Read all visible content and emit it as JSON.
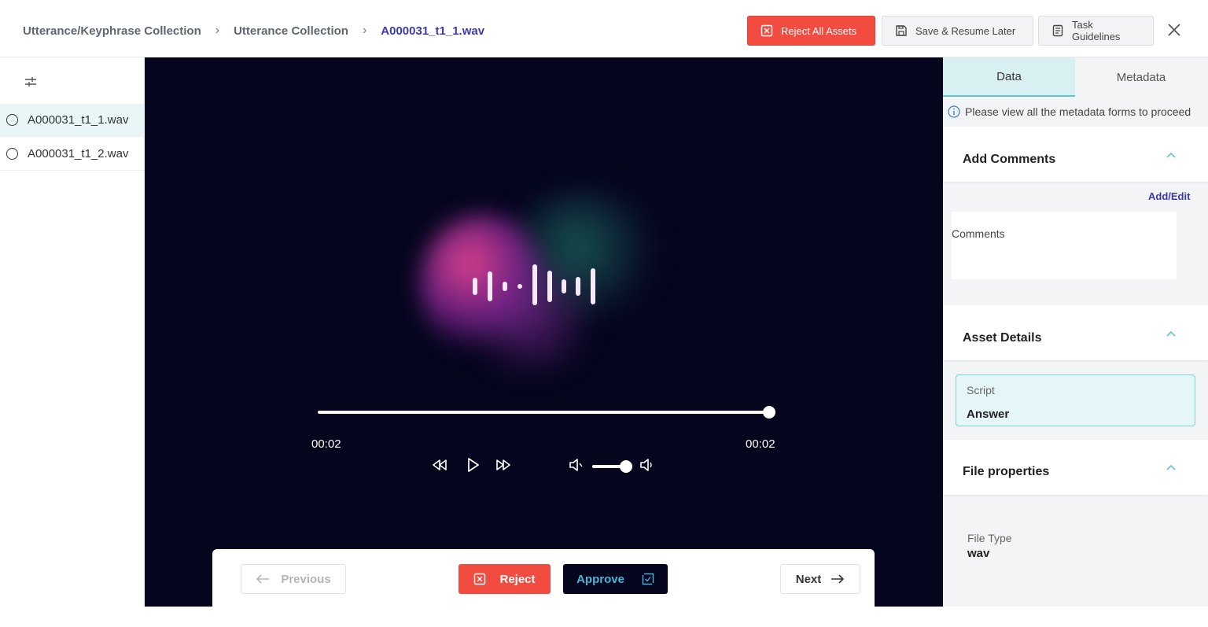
{
  "breadcrumb": {
    "items": [
      "Utterance/Keyphrase Collection",
      "Utterance Collection",
      "A000031_t1_1.wav"
    ]
  },
  "header": {
    "reject_all_label": "Reject All Assets",
    "save_label": "Save & Resume Later",
    "guidelines_label": "Task Guidelines"
  },
  "sidebar": {
    "files": [
      {
        "name": "A000031_t1_1.wav",
        "selected": true
      },
      {
        "name": "A000031_t1_2.wav",
        "selected": false
      }
    ]
  },
  "player": {
    "current_time": "00:02",
    "duration": "00:02",
    "progress": 1.0,
    "volume": 1.0
  },
  "nav": {
    "previous_label": "Previous",
    "reject_label": "Reject",
    "approve_label": "Approve",
    "next_label": "Next"
  },
  "panel": {
    "tabs": [
      "Data",
      "Metadata"
    ],
    "active_tab": "Data",
    "notice": "Please view all the metadata forms to proceed",
    "comments_section": {
      "title": "Add Comments",
      "action": "Add/Edit",
      "placeholder": "Comments"
    },
    "asset_details": {
      "title": "Asset Details",
      "script_label": "Script",
      "script_value": "Answer"
    },
    "file_properties": {
      "title": "File properties",
      "file_type_label": "File Type",
      "file_type_value": "wav"
    }
  },
  "colors": {
    "accent": "#3d3aa8",
    "danger": "#f24b3f",
    "teal": "#5cc6d5",
    "player_bg": "#05051e"
  }
}
